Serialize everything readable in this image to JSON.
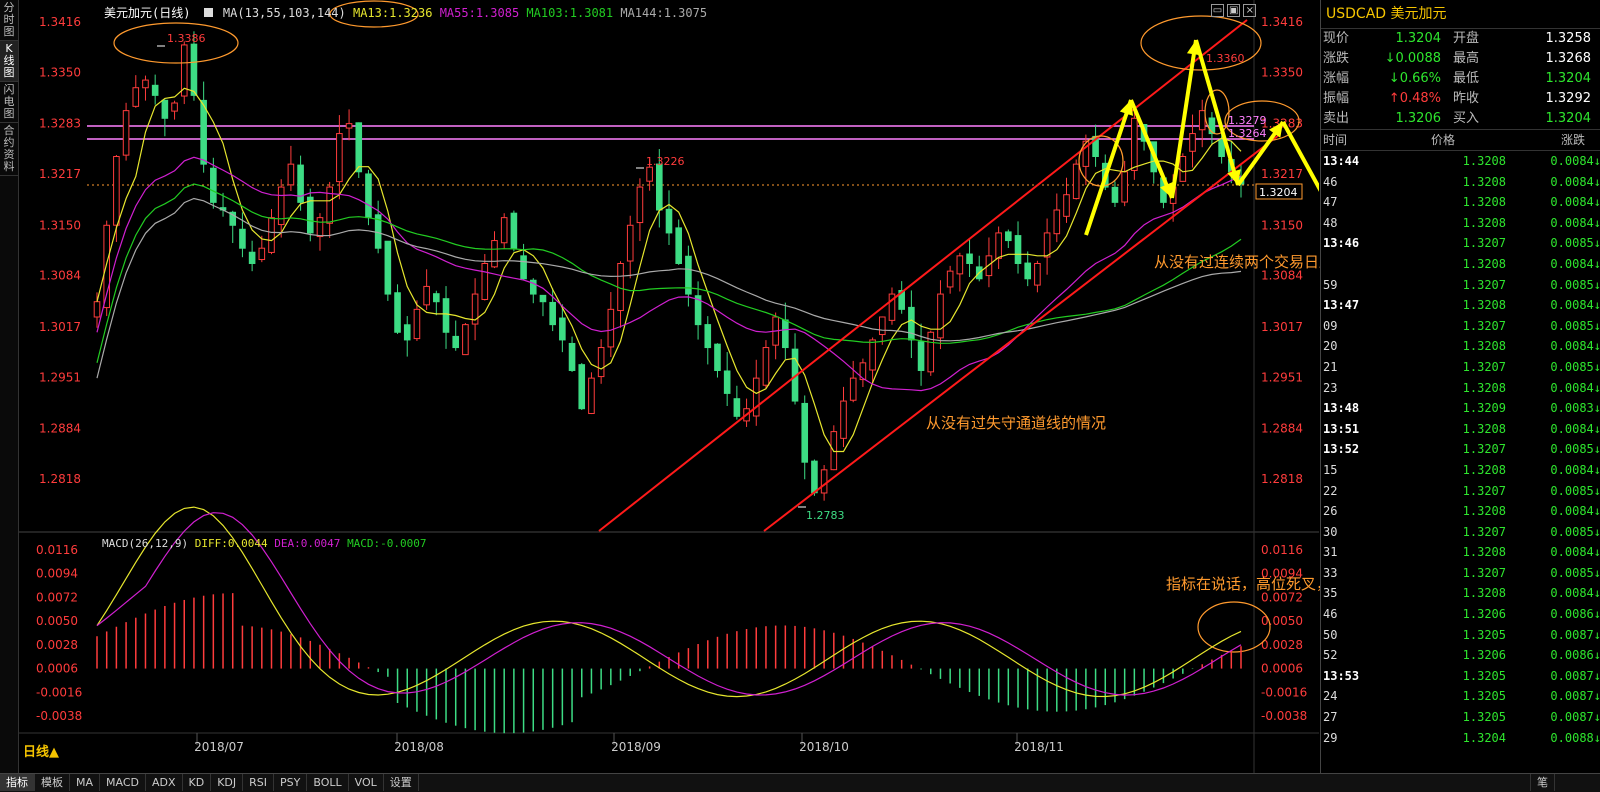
{
  "left_tabs": [
    "分时图",
    "K线图",
    "闪电图",
    "合约资料"
  ],
  "legend": {
    "title": "美元加元(日线)",
    "ma_label": "MA(13,55,103,144)",
    "ma13": "MA13:1.3236",
    "ma55": "MA55:1.3085",
    "ma103": "MA103:1.3081",
    "ma144": "MA144:1.3075"
  },
  "macd_legend": {
    "name": "MACD(26,12,9)",
    "diff": "DIFF:0.0044",
    "dea": "DEA:0.0047",
    "macd": "MACD:-0.0007"
  },
  "price_axis": [
    "1.3416",
    "1.3350",
    "1.3283",
    "1.3217",
    "1.3150",
    "1.3084",
    "1.3017",
    "1.2951",
    "1.2884",
    "1.2818"
  ],
  "macd_axis": [
    "0.0116",
    "0.0094",
    "0.0072",
    "0.0050",
    "0.0028",
    "0.0006",
    "-0.0016",
    "-0.0038"
  ],
  "date_labels": [
    "2018/07",
    "2018/08",
    "2018/09",
    "2018/10",
    "2018/11"
  ],
  "period_label": "日线▲",
  "price_marks": {
    "high1": "1.3386",
    "mid": "1.3226",
    "low": "1.2783",
    "high2": "1.3360",
    "box1": "1.3279",
    "box2": "1.3264",
    "current": "1.3204"
  },
  "annotations": {
    "note1": "从没有过连续两个交易日跌破黄线支撑",
    "note2": "从没有过失守通道线的情况",
    "note3": "指标在说话，高位死叉，多头九死一生"
  },
  "bottom_tabs": [
    "指标",
    "模板",
    "MA",
    "MACD",
    "ADX",
    "KD",
    "KDJ",
    "RSI",
    "PSY",
    "BOLL",
    "VOL",
    "设置"
  ],
  "bottom_right_tab": "笔",
  "panel": {
    "title": "USDCAD 美元加元",
    "quotes": [
      {
        "l1": "现价",
        "v1": "1.3204",
        "c1": "green",
        "l2": "开盘",
        "v2": "1.3258",
        "c2": "white"
      },
      {
        "l1": "涨跌",
        "v1": "↓0.0088",
        "c1": "green",
        "l2": "最高",
        "v2": "1.3268",
        "c2": "white"
      },
      {
        "l1": "涨幅",
        "v1": "↓0.66%",
        "c1": "green",
        "l2": "最低",
        "v2": "1.3204",
        "c2": "green"
      },
      {
        "l1": "振幅",
        "v1": "↑0.48%",
        "c1": "red",
        "l2": "昨收",
        "v2": "1.3292",
        "c2": "white"
      },
      {
        "l1": "卖出",
        "v1": "1.3206",
        "c1": "green",
        "l2": "买入",
        "v2": "1.3204",
        "c2": "green"
      }
    ],
    "table_headers": [
      "时间",
      "价格",
      "涨跌"
    ],
    "ticks": [
      {
        "t": "13:44",
        "p": "1.3208",
        "c": "0.0084↓",
        "min": true
      },
      {
        "t": "46",
        "p": "1.3208",
        "c": "0.0084↓",
        "min": false
      },
      {
        "t": "47",
        "p": "1.3208",
        "c": "0.0084↓",
        "min": false
      },
      {
        "t": "48",
        "p": "1.3208",
        "c": "0.0084↓",
        "min": false
      },
      {
        "t": "13:46",
        "p": "1.3207",
        "c": "0.0085↓",
        "min": true
      },
      {
        "t": "",
        "p": "1.3208",
        "c": "0.0084↓",
        "min": false
      },
      {
        "t": "59",
        "p": "1.3207",
        "c": "0.0085↓",
        "min": false
      },
      {
        "t": "13:47",
        "p": "1.3208",
        "c": "0.0084↓",
        "min": true
      },
      {
        "t": "09",
        "p": "1.3207",
        "c": "0.0085↓",
        "min": false
      },
      {
        "t": "20",
        "p": "1.3208",
        "c": "0.0084↓",
        "min": false
      },
      {
        "t": "21",
        "p": "1.3207",
        "c": "0.0085↓",
        "min": false
      },
      {
        "t": "23",
        "p": "1.3208",
        "c": "0.0084↓",
        "min": false
      },
      {
        "t": "13:48",
        "p": "1.3209",
        "c": "0.0083↓",
        "min": true
      },
      {
        "t": "13:51",
        "p": "1.3208",
        "c": "0.0084↓",
        "min": true
      },
      {
        "t": "13:52",
        "p": "1.3207",
        "c": "0.0085↓",
        "min": true
      },
      {
        "t": "15",
        "p": "1.3208",
        "c": "0.0084↓",
        "min": false
      },
      {
        "t": "22",
        "p": "1.3207",
        "c": "0.0085↓",
        "min": false
      },
      {
        "t": "26",
        "p": "1.3208",
        "c": "0.0084↓",
        "min": false
      },
      {
        "t": "30",
        "p": "1.3207",
        "c": "0.0085↓",
        "min": false
      },
      {
        "t": "31",
        "p": "1.3208",
        "c": "0.0084↓",
        "min": false
      },
      {
        "t": "33",
        "p": "1.3207",
        "c": "0.0085↓",
        "min": false
      },
      {
        "t": "35",
        "p": "1.3208",
        "c": "0.0084↓",
        "min": false
      },
      {
        "t": "46",
        "p": "1.3206",
        "c": "0.0086↓",
        "min": false
      },
      {
        "t": "50",
        "p": "1.3205",
        "c": "0.0087↓",
        "min": false
      },
      {
        "t": "52",
        "p": "1.3206",
        "c": "0.0086↓",
        "min": false
      },
      {
        "t": "13:53",
        "p": "1.3205",
        "c": "0.0087↓",
        "min": true
      },
      {
        "t": "24",
        "p": "1.3205",
        "c": "0.0087↓",
        "min": false
      },
      {
        "t": "27",
        "p": "1.3205",
        "c": "0.0087↓",
        "min": false
      },
      {
        "t": "29",
        "p": "1.3204",
        "c": "0.0088↓",
        "min": false
      }
    ]
  },
  "colors": {
    "up": "#ff3c3c",
    "down": "#3ddc84",
    "ma13": "#e6e62e",
    "ma55": "#d020d0",
    "ma103": "#22cc22",
    "ma144": "#aaaaaa",
    "channel": "#ff1a1a",
    "arrows": "#ffff00",
    "annotation": "#ff9a2e"
  }
}
